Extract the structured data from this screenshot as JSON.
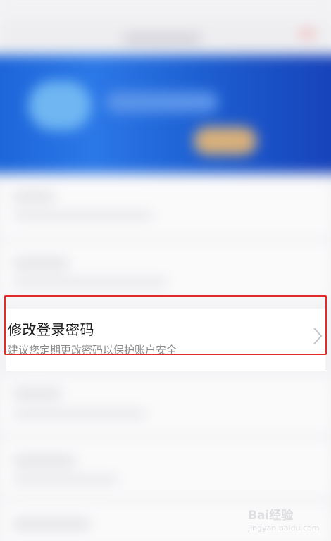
{
  "setting_item": {
    "title": "修改登录密码",
    "subtitle": "建议您定期更改密码以保护账户安全",
    "chevron_icon": "chevron-right-icon"
  },
  "highlight": {
    "color": "#e32a2a"
  },
  "banner": {
    "colors": [
      "#1a63d8",
      "#1640b8"
    ]
  },
  "watermark": {
    "brand": "Bai经验",
    "url": "jingyan.baidu.com"
  }
}
